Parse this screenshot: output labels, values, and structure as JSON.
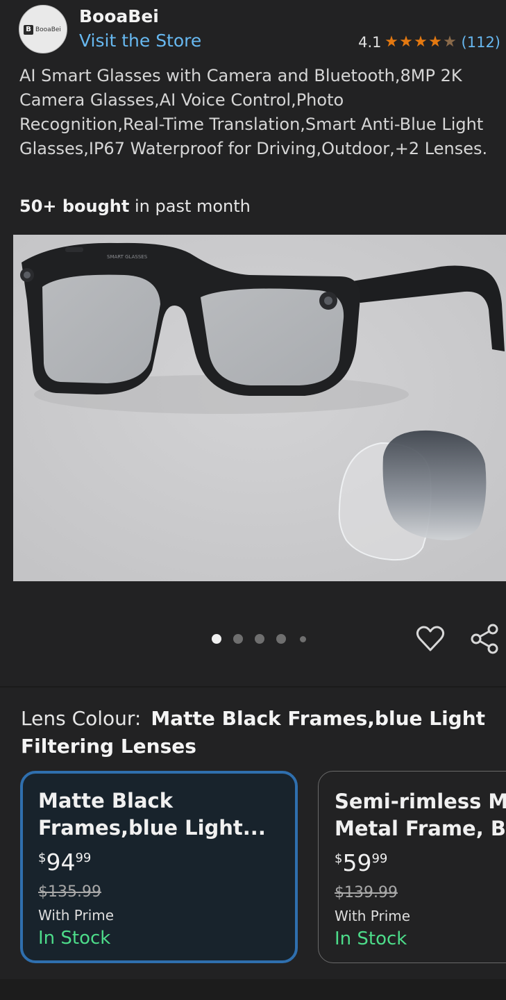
{
  "header": {
    "brand_logo_text": "BooaBei",
    "brand_name": "BooaBei",
    "visit_store": "Visit the Store",
    "rating_value": "4.1",
    "rating_stars": 4.1,
    "rating_count": "(112)"
  },
  "product": {
    "title": "AI Smart Glasses with Camera and Bluetooth,8MP 2K Camera Glasses,AI Voice Control,Photo Recognition,Real-Time Translation,Smart Anti-Blue Light Glasses,IP67 Waterproof for Driving,Outdoor,+2 Lenses.",
    "bought_bold": "50+ bought",
    "bought_rest": " in past month"
  },
  "gallery": {
    "image_count": 5,
    "active_index": 0,
    "frame_marking": "SMART GLASSES"
  },
  "actions": {
    "favorite_icon": "heart-icon",
    "share_icon": "share-icon"
  },
  "variation": {
    "label": "Lens Colour:",
    "selected_value": "Matte Black Frames,blue Light Filtering Lenses",
    "options": [
      {
        "name": "Matte Black\nFrames,blue Light...",
        "currency": "$",
        "price_whole": "94",
        "price_fraction": "99",
        "list_price": "$135.99",
        "prime": "With Prime",
        "stock": "In Stock"
      },
      {
        "name": "Semi-rimless Mat\nMetal Frame, Blu",
        "currency": "$",
        "price_whole": "59",
        "price_fraction": "99",
        "list_price": "$139.99",
        "prime": "With Prime",
        "stock": "In Stock"
      }
    ]
  },
  "colors": {
    "background": "#222223",
    "link": "#67b8f0",
    "star": "#e47911",
    "selected_border": "#2f6fae",
    "in_stock": "#4ddc8a"
  }
}
